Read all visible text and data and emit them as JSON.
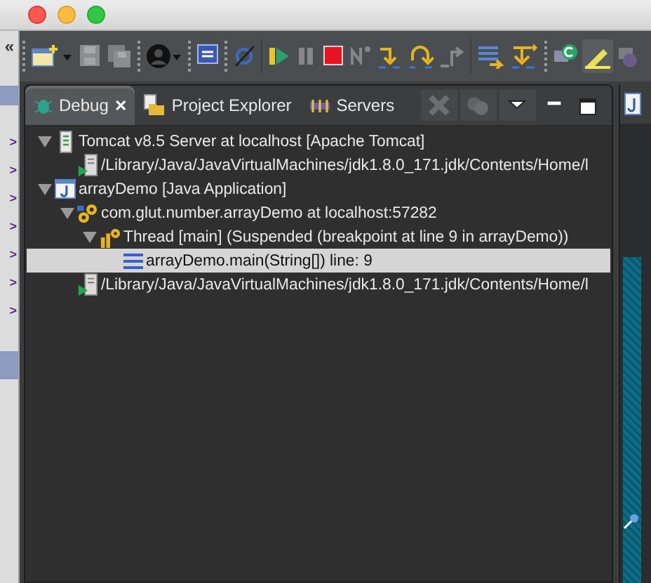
{
  "side_strip": {
    "collapse": "«",
    "marks": [
      ">",
      ">",
      ">",
      ">",
      ">",
      ">",
      ">"
    ]
  },
  "view": {
    "tabs": [
      {
        "label": "Debug",
        "selected": true,
        "close": "✕"
      },
      {
        "label": "Project Explorer",
        "selected": false
      },
      {
        "label": "Servers",
        "selected": false
      }
    ],
    "tree": [
      {
        "kind": "server",
        "label": "Tomcat v8.5 Server at localhost [Apache Tomcat]",
        "expanded": true,
        "selected": false,
        "children": [
          {
            "kind": "process",
            "label": "/Library/Java/JavaVirtualMachines/jdk1.8.0_171.jdk/Contents/Home/l",
            "selected": false
          }
        ]
      },
      {
        "kind": "launch",
        "label": "arrayDemo [Java Application]",
        "expanded": true,
        "selected": false,
        "children": [
          {
            "kind": "target",
            "label": "com.glut.number.arrayDemo at localhost:57282",
            "expanded": true,
            "selected": false,
            "children": [
              {
                "kind": "thread",
                "label": "Thread [main] (Suspended (breakpoint at line 9 in arrayDemo))",
                "expanded": true,
                "selected": false,
                "children": [
                  {
                    "kind": "frame",
                    "label": "arrayDemo.main(String[]) line: 9",
                    "selected": true
                  }
                ]
              }
            ]
          },
          {
            "kind": "process",
            "label": "/Library/Java/JavaVirtualMachines/jdk1.8.0_171.jdk/Contents/Home/l",
            "selected": false
          }
        ]
      }
    ]
  }
}
